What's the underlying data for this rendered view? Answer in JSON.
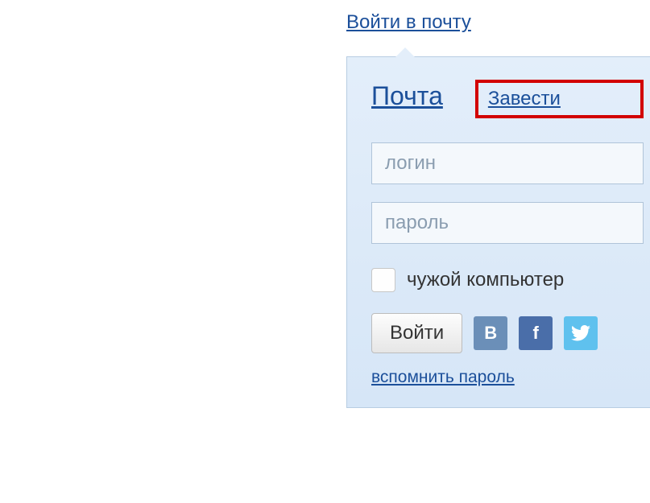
{
  "top": {
    "login_link": "Войти в почту"
  },
  "popup": {
    "title": "Почта",
    "register_link": "Завести",
    "login_placeholder": "логин",
    "password_placeholder": "пароль",
    "foreign_label": "чужой компьютер",
    "submit_label": "Войти",
    "remember_link": "вспомнить пароль",
    "social": {
      "vk": "B",
      "fb": "f",
      "tw": ""
    }
  }
}
